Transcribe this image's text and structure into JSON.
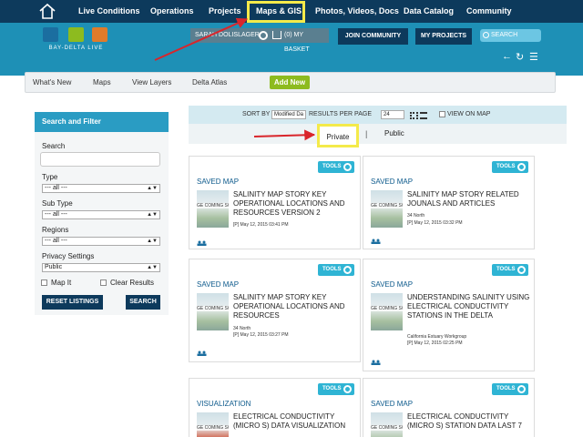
{
  "topnav": {
    "items": [
      "Live Conditions",
      "Operations",
      "Projects",
      "Maps & GIS",
      "Photos, Videos, Docs",
      "Data Catalog",
      "Community"
    ],
    "highlighted": "Maps & GIS"
  },
  "header": {
    "logo_text": "BAY-DELTA LIVE",
    "user": "SARAH DOLISLAGER",
    "basket": "(0) MY BASKET",
    "join_label": "JOIN COMMUNITY",
    "projects_label": "MY PROJECTS",
    "search_label": "SEARCH"
  },
  "subnav": {
    "items": [
      "What's New",
      "Maps",
      "View Layers",
      "Delta Atlas"
    ],
    "add_new": "Add New"
  },
  "sidebar": {
    "title": "Search and Filter",
    "search_label": "Search",
    "type_label": "Type",
    "type_value": "--- all ---",
    "subtype_label": "Sub Type",
    "subtype_value": "--- all ---",
    "regions_label": "Regions",
    "regions_value": "--- all ---",
    "privacy_label": "Privacy Settings",
    "privacy_value": "Public",
    "map_it": "Map It",
    "clear_results": "Clear Results",
    "reset_btn": "RESET LISTINGS",
    "search_btn": "SEARCH"
  },
  "sortbar": {
    "sort_by": "SORT BY",
    "sort_value": "Modified Da",
    "per_page_label": "RESULTS PER PAGE",
    "per_page_value": "24",
    "view_on_map": "VIEW ON MAP"
  },
  "filter": {
    "private": "Private",
    "sep": "|",
    "public": "Public"
  },
  "cards": [
    {
      "type": "SAVED MAP",
      "title": "SALINITY MAP STORY KEY OPERATIONAL LOCATIONS AND RESOURCES VERSION 2",
      "sub": "",
      "date": "[P] May 12, 2015 03:41 PM",
      "thumb": "GE COMING SO"
    },
    {
      "type": "SAVED MAP",
      "title": "SALINITY MAP STORY RELATED JOUNALS AND ARTICLES",
      "sub": "34 North",
      "date": "[P] May 12, 2015 03:32 PM",
      "thumb": "GE COMING SO"
    },
    {
      "type": "SAVED MAP",
      "title": "SALINITY MAP STORY KEY OPERATIONAL LOCATIONS AND RESOURCES",
      "sub": "34 North",
      "date": "[P] May 12, 2015 03:27 PM",
      "thumb": "GE COMING SO"
    },
    {
      "type": "SAVED MAP",
      "title": "UNDERSTANDING SALINITY USING ELECTRICAL CONDUCTIVITY STATIONS IN THE DELTA",
      "sub": "California Estuary Workgroup",
      "date": "[P] May 12, 2015 02:25 PM",
      "thumb": "GE COMING SO"
    },
    {
      "type": "VISUALIZATION",
      "title": "ELECTRICAL CONDUCTIVITY (MICRO S) DATA VISUALIZATION",
      "sub": "",
      "date": "",
      "thumb": "GE COMING SO"
    },
    {
      "type": "SAVED MAP",
      "title": "ELECTRICAL CONDUCTIVITY (MICRO S) STATION DATA LAST 7",
      "sub": "",
      "date": "",
      "thumb": "GE COMING SO"
    }
  ],
  "tools_label": "TOOLS",
  "colors": {
    "nav": "#0d3a5c",
    "header": "#1e90b6",
    "accent": "#2fb4d4",
    "add_new": "#8dbb1f",
    "highlight": "#f4ea4a",
    "arrow": "#d9252b"
  }
}
